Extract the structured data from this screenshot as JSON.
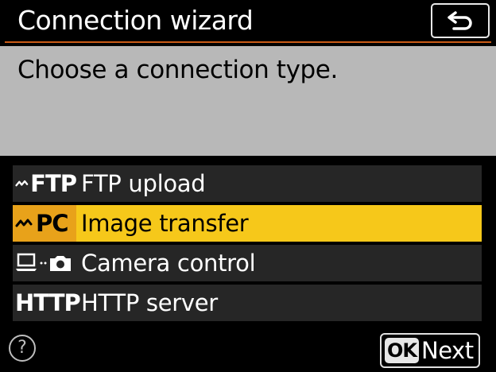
{
  "header": {
    "title": "Connection wizard",
    "back_icon": "return-arrow-icon"
  },
  "prompt": {
    "text": "Choose a connection type."
  },
  "menu": {
    "selected_index": 1,
    "items": [
      {
        "icon_text": "FTP",
        "icon": "wireless-ftp-icon",
        "label": "FTP upload"
      },
      {
        "icon_text": "PC",
        "icon": "wireless-pc-icon",
        "label": "Image transfer"
      },
      {
        "icon_text": "",
        "icon": "laptop-camera-icon",
        "label": "Camera control"
      },
      {
        "icon_text": "HTTP",
        "icon": "http-icon",
        "label": "HTTP server"
      }
    ]
  },
  "footer": {
    "help_glyph": "?",
    "ok_text": "OK",
    "next_label": "Next"
  },
  "colors": {
    "accent_rule": "#c85a16",
    "selected_bg": "#f6c81a",
    "selected_icon_bg": "#e8a21a",
    "panel_bg": "#b8b8b8",
    "item_bg": "#262626"
  }
}
